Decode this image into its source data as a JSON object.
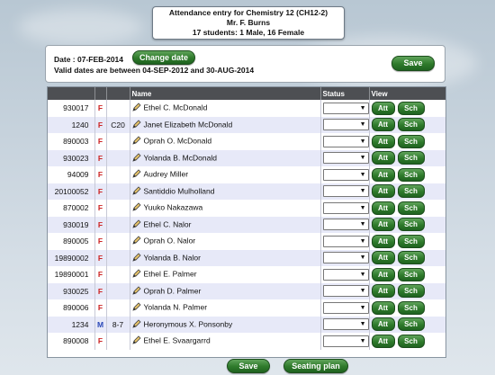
{
  "header": {
    "title": "Attendance entry for Chemistry 12 (CH12-2)",
    "teacher": "Mr. F. Burns",
    "summary": "17 students: 1 Male, 16 Female"
  },
  "panel": {
    "date_text": "Date : 07-FEB-2014",
    "change_date_label": "Change date",
    "valid_dates_text": "Valid dates are between  04-SEP-2012 and 30-AUG-2014",
    "save_label": "Save"
  },
  "table": {
    "columns": [
      "",
      "",
      "",
      "Name",
      "Status",
      "View"
    ],
    "rows": [
      {
        "id": "930017",
        "gender": "F",
        "hr": "",
        "name": "Ethel C. McDonald"
      },
      {
        "id": "1240",
        "gender": "F",
        "hr": "C20",
        "name": "Janet Elizabeth McDonald"
      },
      {
        "id": "890003",
        "gender": "F",
        "hr": "",
        "name": "Oprah O. McDonald"
      },
      {
        "id": "930023",
        "gender": "F",
        "hr": "",
        "name": "Yolanda B. McDonald"
      },
      {
        "id": "94009",
        "gender": "F",
        "hr": "",
        "name": "Audrey Miller"
      },
      {
        "id": "20100052",
        "gender": "F",
        "hr": "",
        "name": "Santiddio Mulholland"
      },
      {
        "id": "870002",
        "gender": "F",
        "hr": "",
        "name": "Yuuko Nakazawa"
      },
      {
        "id": "930019",
        "gender": "F",
        "hr": "",
        "name": "Ethel C. Nalor"
      },
      {
        "id": "890005",
        "gender": "F",
        "hr": "",
        "name": "Oprah O. Nalor"
      },
      {
        "id": "19890002",
        "gender": "F",
        "hr": "",
        "name": "Yolanda B. Nalor"
      },
      {
        "id": "19890001",
        "gender": "F",
        "hr": "",
        "name": "Ethel E. Palmer"
      },
      {
        "id": "930025",
        "gender": "F",
        "hr": "",
        "name": "Oprah D. Palmer"
      },
      {
        "id": "890006",
        "gender": "F",
        "hr": "",
        "name": "Yolanda N. Palmer"
      },
      {
        "id": "1234",
        "gender": "M",
        "hr": "8-7",
        "name": "Heronymous X. Ponsonby"
      },
      {
        "id": "890008",
        "gender": "F",
        "hr": "",
        "name": "Ethel E. Svaargarrd"
      }
    ],
    "status_value": "",
    "att_label": "Att",
    "sch_label": "Sch"
  },
  "footer": {
    "save_label": "Save",
    "seating_plan_label": "Seating plan"
  },
  "colors": {
    "button_green": "#2e7a2b",
    "header_dark": "#4d4f53",
    "row_alt": "#e7e9f8",
    "female_marker": "#cc2222",
    "male_marker": "#2a48b8"
  }
}
